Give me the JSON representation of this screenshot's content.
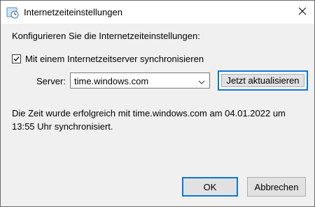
{
  "window": {
    "title": "Internetzeiteinstellungen",
    "icons": {
      "app": "clock-globe-icon",
      "close": "close-icon"
    }
  },
  "content": {
    "heading": "Konfigurieren Sie die Internetzeiteinstellungen:",
    "sync_checkbox": {
      "label": "Mit einem Internetzeitserver synchronisieren",
      "checked": true
    },
    "server": {
      "label": "Server:",
      "value": "time.windows.com",
      "icon": "chevron-down-icon"
    },
    "update_button": "Jetzt aktualisieren",
    "status": "Die Zeit wurde erfolgreich mit time.windows.com am 04.01.2022 um 13:55 Uhr synchronisiert."
  },
  "buttons": {
    "ok": "OK",
    "cancel": "Abbrechen"
  },
  "colors": {
    "accent": "#0a78d4",
    "window_bg": "#f0f0f0",
    "button_bg": "#e1e1e1"
  }
}
